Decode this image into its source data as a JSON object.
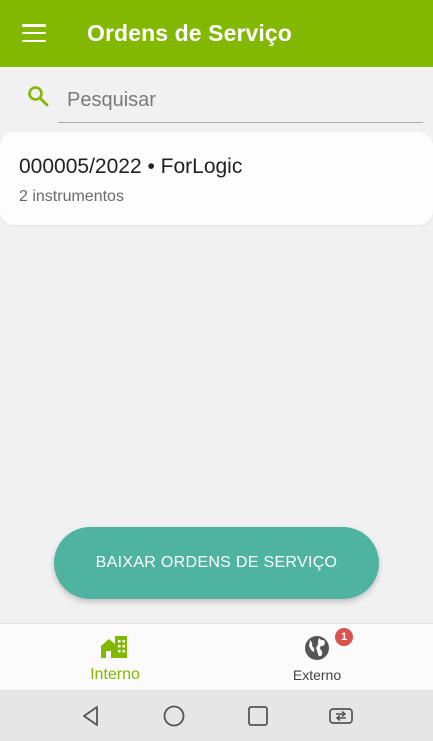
{
  "appbar": {
    "title": "Ordens de Serviço",
    "menu_icon": "hamburger-menu-icon"
  },
  "search": {
    "placeholder": "Pesquisar",
    "value": "",
    "icon": "search-icon"
  },
  "orders": [
    {
      "title": "000005/2022 • ForLogic",
      "subtitle": "2 instrumentos"
    }
  ],
  "download_button": {
    "label": "BAIXAR ORDENS DE SERVIÇO"
  },
  "bottom_nav": {
    "items": [
      {
        "label": "Interno",
        "icon": "building-icon",
        "active": true
      },
      {
        "label": "Externo",
        "icon": "globe-icon",
        "badge": "1"
      }
    ]
  },
  "system_nav": {
    "icons": [
      "back-icon",
      "home-icon",
      "recents-icon",
      "switch-app-icon"
    ]
  },
  "colors": {
    "primary": "#82b800",
    "accent": "#4fb3a2",
    "badge": "#d9534f",
    "background": "#f1f1f1"
  }
}
